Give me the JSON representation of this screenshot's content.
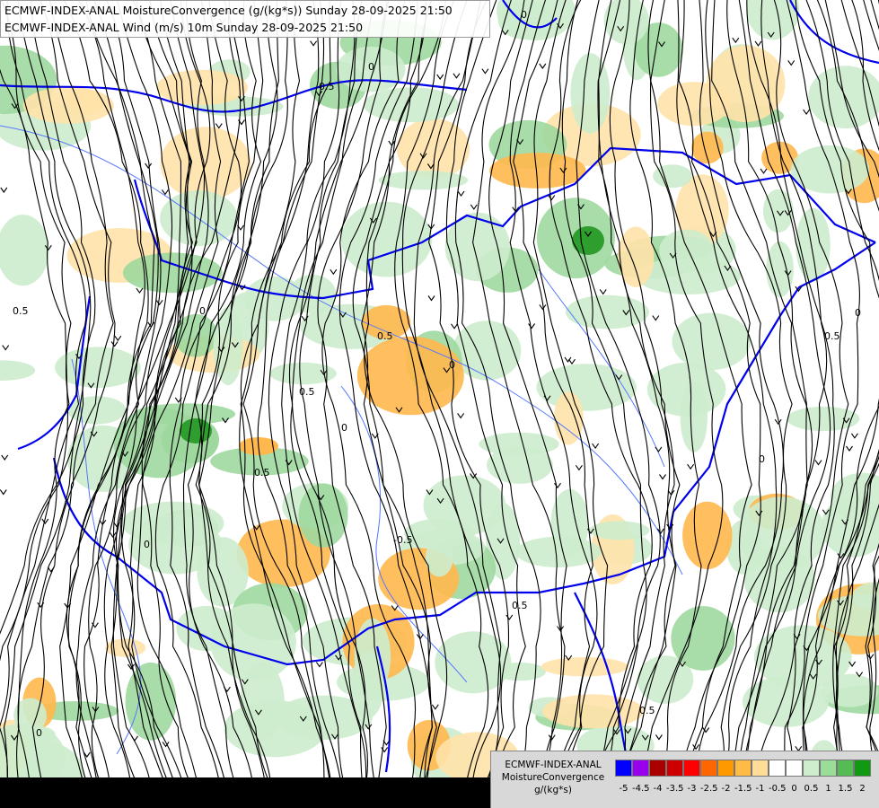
{
  "title": {
    "line1": "ECMWF-INDEX-ANAL MoistureConvergence (g/(kg*s)) Sunday 28-09-2025 21:50",
    "line2": "ECMWF-INDEX-ANAL Wind (m/s) 10m Sunday 28-09-2025 21:50"
  },
  "legend": {
    "title_line1": "ECMWF-INDEX-ANAL",
    "title_line2": "MoistureConvergence",
    "unit": "g/(kg*s)",
    "swatch_colors": [
      "#0000ff",
      "#9900ee",
      "#aa0000",
      "#cc0000",
      "#ff0000",
      "#ff6600",
      "#ff9900",
      "#ffbb44",
      "#ffdd99",
      "#ffffff",
      "#ffffff",
      "#cceecc",
      "#99dd99",
      "#55bb55",
      "#119911"
    ],
    "tick_labels": [
      "-5",
      "-4.5",
      "-4",
      "-3.5",
      "-3",
      "-2.5",
      "-2",
      "-1.5",
      "-1",
      "-0.5",
      "0",
      "0.5",
      "1",
      "1.5",
      "2"
    ]
  },
  "map_labels": [
    "0",
    "0.5",
    "0",
    "0.5",
    "0",
    "0.5",
    "0",
    "0.5",
    "0",
    "0.5",
    "0",
    "-0.5",
    "0.5",
    "0",
    "0.5",
    "0",
    "0.5",
    "0"
  ],
  "colors": {
    "border": "#0000ee",
    "river": "#5577ff",
    "streamline": "#000000",
    "green_light": "#cdeccd",
    "green_mid": "#9fd89f",
    "green_dark": "#2e9e2e",
    "orange_light": "#ffe2a8",
    "orange_mid": "#ffb84d"
  }
}
